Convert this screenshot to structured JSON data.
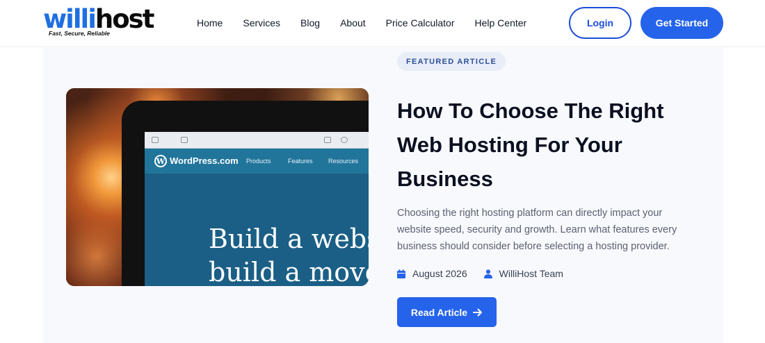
{
  "brand": {
    "name_part1": "willi",
    "name_part2": "host",
    "tagline": "Fast, Secure, Reliable",
    "primary_color": "#2563eb"
  },
  "nav": {
    "items": [
      "Home",
      "Services",
      "Blog",
      "About",
      "Price Calculator",
      "Help Center"
    ],
    "login_label": "Login",
    "get_started_label": "Get Started"
  },
  "article": {
    "badge": "FEATURED ARTICLE",
    "title": "How To Choose The Right Web Hosting For Your Business",
    "description": "Choosing the right hosting platform can directly impact your website speed, security and growth. Learn what features every business should consider before selecting a hosting provider.",
    "date": "August 2026",
    "author": "WilliHost Team",
    "cta_label": "Read Article",
    "image": {
      "site_name": "WordPress.com",
      "nav_items": [
        "Products",
        "Features",
        "Resources"
      ],
      "headline_line1": "Build a webs",
      "headline_line2": "build a move"
    }
  }
}
